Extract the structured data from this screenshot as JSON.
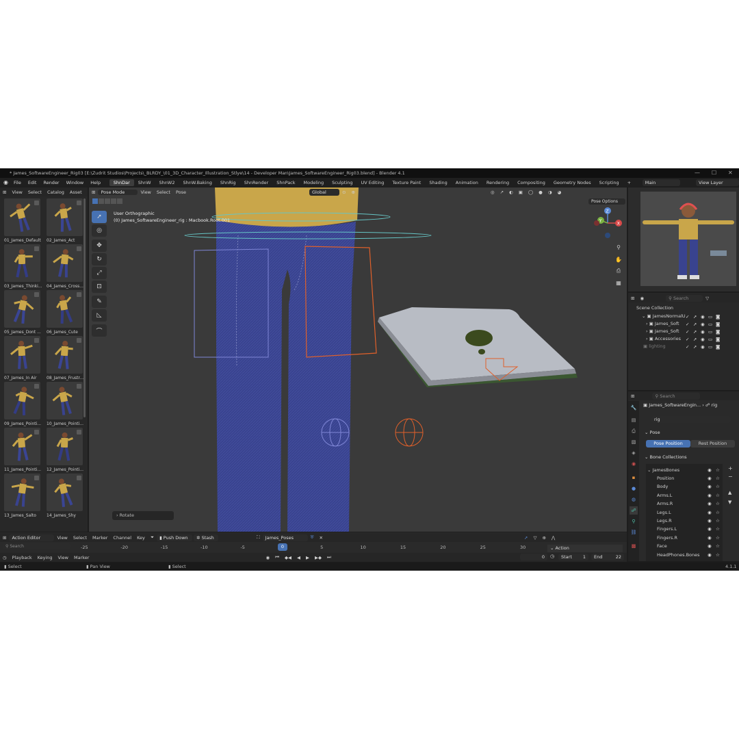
{
  "window": {
    "title": "* James_SoftwareEngineer_Rig03 [E:\\Zudrit Studios\\Projects\\_BLRDY_\\01_3D_Character_Illustration_Stlye\\14 - Developer Man\\James_SoftwareEngineer_Rig03.blend] - Blender 4.1"
  },
  "menu": [
    "File",
    "Edit",
    "Render",
    "Window",
    "Help"
  ],
  "workspaces": [
    {
      "label": "ShnDar",
      "active": true
    },
    {
      "label": "ShnW",
      "active": false
    },
    {
      "label": "ShnW2",
      "active": false
    },
    {
      "label": "ShnW.Baking",
      "active": false
    },
    {
      "label": "ShnRig",
      "active": false
    },
    {
      "label": "ShnRender",
      "active": false
    },
    {
      "label": "ShnPack",
      "active": false
    },
    {
      "label": "Modeling",
      "active": false
    },
    {
      "label": "Sculpting",
      "active": false
    },
    {
      "label": "UV Editing",
      "active": false
    },
    {
      "label": "Texture Paint",
      "active": false
    },
    {
      "label": "Shading",
      "active": false
    },
    {
      "label": "Animation",
      "active": false
    },
    {
      "label": "Rendering",
      "active": false
    },
    {
      "label": "Compositing",
      "active": false
    },
    {
      "label": "Geometry Nodes",
      "active": false
    },
    {
      "label": "Scripting",
      "active": false
    }
  ],
  "scene": {
    "name": "Main",
    "view_layer": "View Layer"
  },
  "asset_browser": {
    "menus": [
      "View",
      "Select",
      "Catalog",
      "Asset"
    ],
    "items": [
      "01_James_Default",
      "02_James_Act",
      "03_James_Thinki...",
      "04_James_Cross...",
      "05_James_Dont ...",
      "06_James_Cute",
      "07_James_In Air",
      "08_James_Frustr...",
      "09_James_Pointi...",
      "10_James_Pointi...",
      "11_James_Pointi...",
      "12_James_Pointi...",
      "13_James_Salto",
      "14_James_Shy"
    ]
  },
  "viewport": {
    "mode": "Pose Mode",
    "menus": [
      "View",
      "Select",
      "Pose"
    ],
    "transform_orientation": "Global",
    "pose_options": "Pose Options",
    "view_name": "User Orthographic",
    "object_info": "(0) James_SoftwareEngineer_rig : Macbook.Root.001",
    "last_op": "Rotate",
    "gizmo": {
      "z": "Z",
      "y": "Y",
      "x": "X"
    }
  },
  "outliner": {
    "search_placeholder": "Search",
    "root": "Scene Collection",
    "items": [
      "JamesNormalU",
      "James_Soft",
      "James_Soft",
      "Accessories",
      "lighting"
    ]
  },
  "properties": {
    "search_placeholder": "Search",
    "breadcrumb_object": "James_SoftwareEngin...",
    "breadcrumb_data": "rig",
    "data_name": "rig",
    "pose_section": "Pose",
    "pose_position": "Pose Position",
    "rest_position": "Rest Position",
    "bone_collections_section": "Bone Collections",
    "bone_root": "JamesBones",
    "bones": [
      "Position",
      "Body",
      "Arms.L",
      "Arms.R",
      "Legs.L",
      "Legs.R",
      "Fingers.L",
      "Fingers.R",
      "Face",
      "HeadPhones.Bones"
    ]
  },
  "action_editor": {
    "mode": "Action Editor",
    "menus": [
      "View",
      "Select",
      "Marker",
      "Channel",
      "Key"
    ],
    "push_down": "Push Down",
    "stash": "Stash",
    "action_name": "James_Poses",
    "search_placeholder": "Search",
    "channel": "Action",
    "ticks": [
      "-25",
      "-20",
      "-15",
      "-10",
      "-5",
      "0",
      "5",
      "10",
      "15",
      "20",
      "25",
      "30"
    ],
    "current_frame": "0"
  },
  "timeline": {
    "menus": [
      "Playback",
      "Keying",
      "View",
      "Marker"
    ],
    "frame": "0",
    "start_label": "Start",
    "start": "1",
    "end_label": "End",
    "end": "22"
  },
  "statusbar": {
    "select": "Select",
    "pan_view": "Pan View",
    "select2": "Select",
    "version": "4.1.1"
  },
  "colors": {
    "accent": "#4772b3",
    "pants": "#39438f",
    "shirt": "#c9a64a",
    "selected_bone": "#e0602a"
  }
}
